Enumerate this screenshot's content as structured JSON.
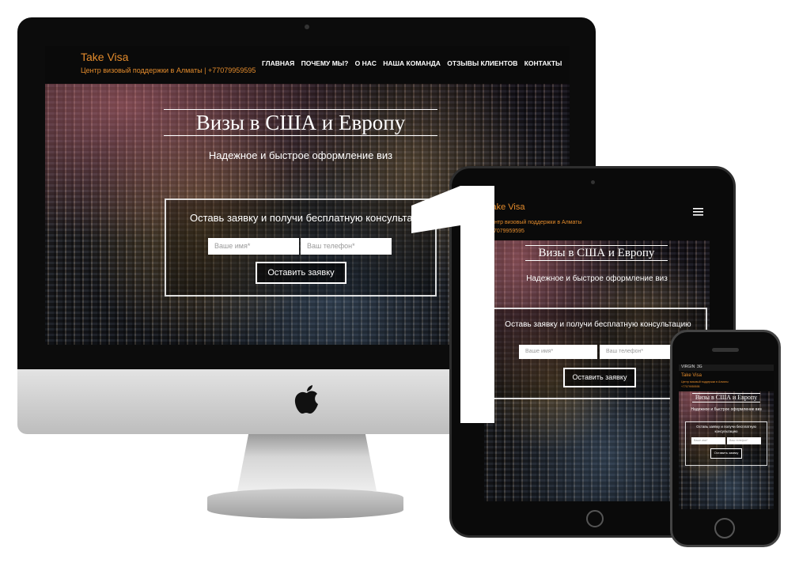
{
  "site": {
    "brand": "Take Visa",
    "tagline": "Центр визовый поддержки в Алматы | +77079959595",
    "tagline_short": "Центр визовый поддержки в Алматы",
    "phone": "+77079959595",
    "nav": [
      "ГЛАВНАЯ",
      "ПОЧЕМУ МЫ?",
      "О НАС",
      "НАША КОМАНДА",
      "ОТЗЫВЫ КЛИЕНТОВ",
      "КОНТАКТЫ"
    ],
    "hero_title": "Визы в США и Европу",
    "hero_subtitle": "Надежное и быстрое оформление виз",
    "form_heading": "Оставь заявку и получи бесплатную консультацию",
    "name_placeholder": "Ваше имя*",
    "phone_placeholder": "Ваш телефон*",
    "submit_label": "Оставить заявку"
  },
  "ipad": {
    "brand": "Take Visa"
  },
  "iphone": {
    "status": "VIRGIN  3G",
    "brand": "Take Visa",
    "form_heading_line1": "Оставь заявку и получи бесплатную",
    "form_heading_line2": "консультацию"
  },
  "overlay": {
    "number": "1"
  },
  "colors": {
    "brand_orange": "#e38b2c",
    "nav_bg": "#0a0a0a"
  },
  "icons": [
    "apple-logo-icon",
    "hamburger-menu-icon"
  ]
}
